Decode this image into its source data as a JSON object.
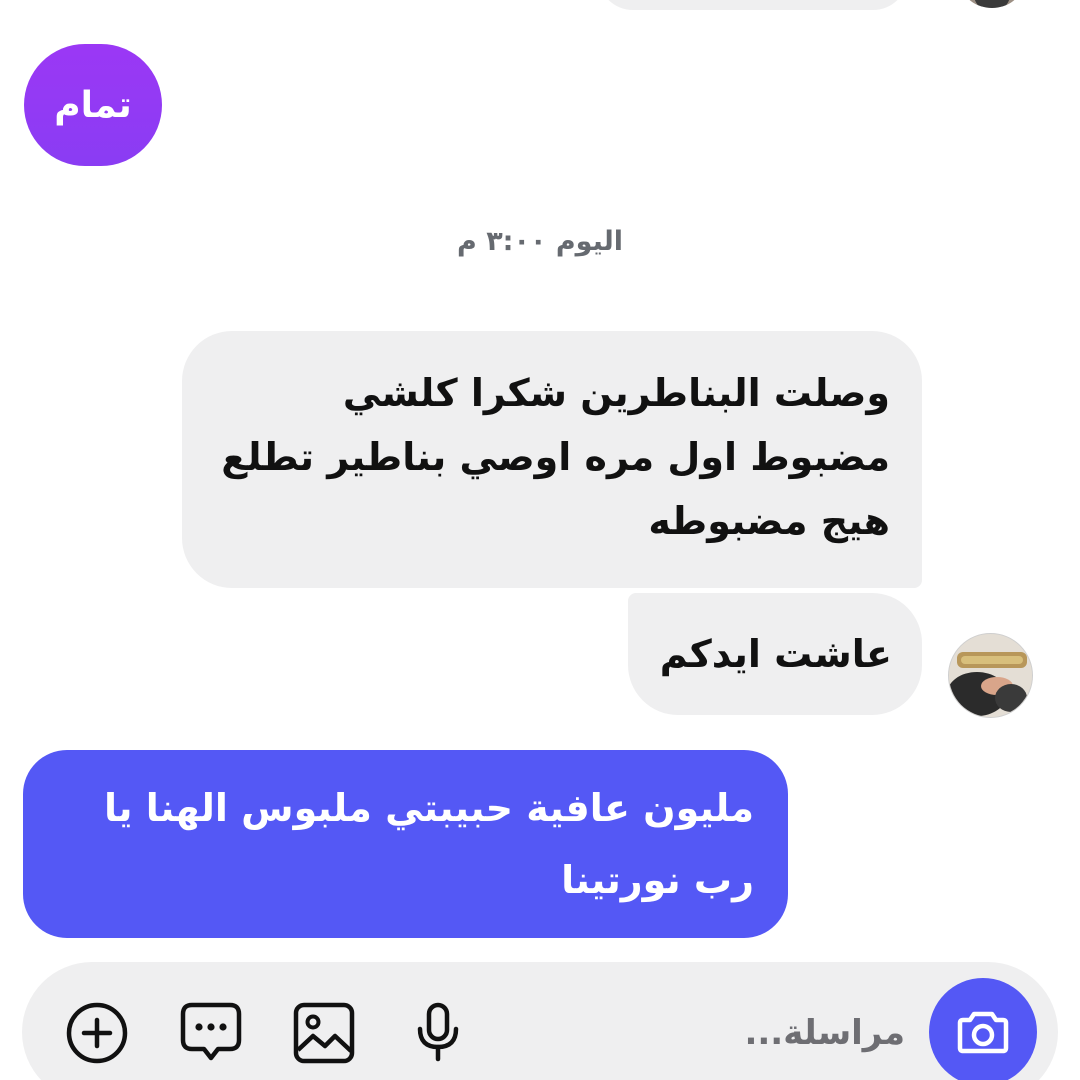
{
  "thread": {
    "messages": [
      {
        "side": "outgoing",
        "text": "تمام"
      },
      {
        "side": "incoming",
        "text": "وصلت البناطرين شكرا كلشي مضبوط اول مره اوصي بناطير تطلع هيج مضبوطه"
      },
      {
        "side": "incoming",
        "text": "عاشت ايدكم"
      },
      {
        "side": "outgoing",
        "text": "مليون عافية حبيبتي ملبوس الهنا يا رب نورتينا"
      }
    ],
    "timestamp": "اليوم ٣:٠٠ م"
  },
  "composer": {
    "placeholder": "مراسلة...",
    "value": "",
    "icons": {
      "camera": "camera-icon",
      "mic": "microphone-icon",
      "gallery": "image-icon",
      "sticker": "chat-bubble-icon",
      "more": "plus-circle-icon"
    }
  },
  "colors": {
    "outgoing_blue": "#5458f5",
    "outgoing_purple": "#9b38f5",
    "incoming_grey": "#efeff0",
    "timestamp_grey": "#666a70"
  }
}
